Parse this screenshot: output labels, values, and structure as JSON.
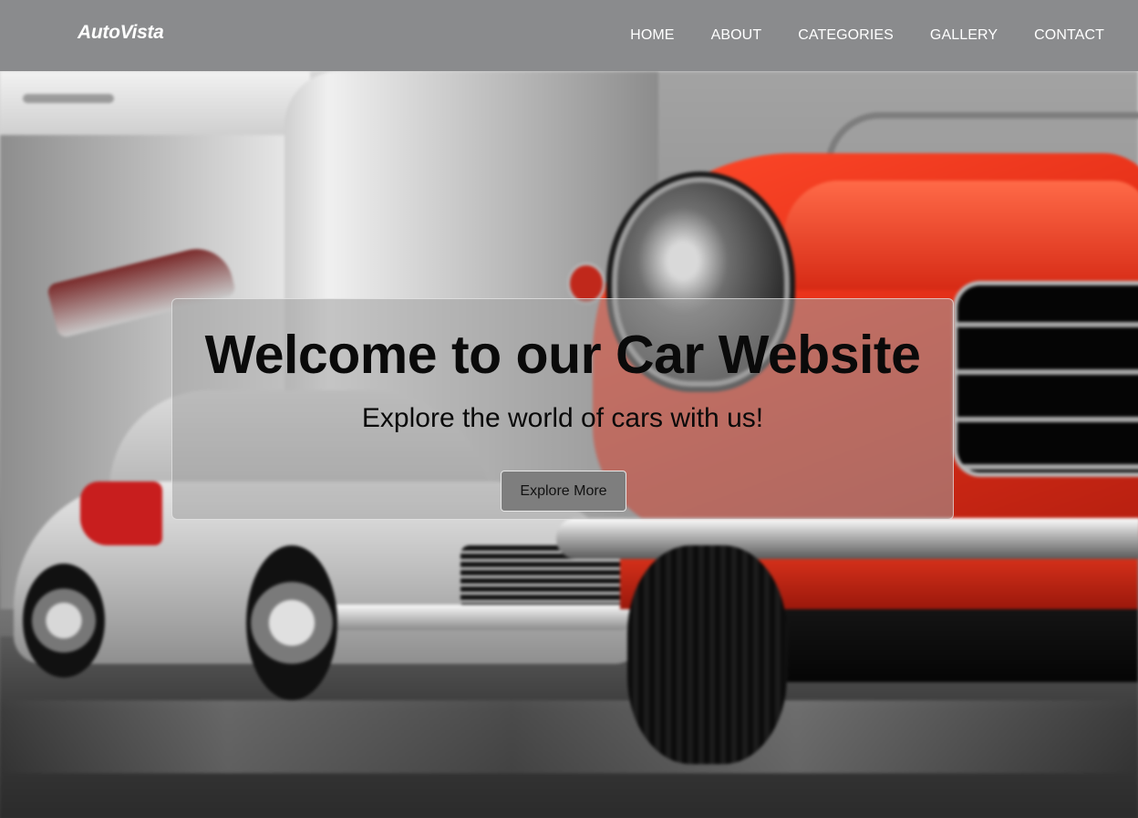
{
  "header": {
    "brand": "AutoVista",
    "nav": [
      {
        "label": "HOME"
      },
      {
        "label": "ABOUT"
      },
      {
        "label": "CATEGORIES"
      },
      {
        "label": "GALLERY"
      },
      {
        "label": "CONTACT"
      }
    ]
  },
  "hero": {
    "title": "Welcome to our Car Website",
    "subtitle": "Explore the world of cars with us!",
    "button_label": "Explore More",
    "background_image": "classic-cars-showroom-photo"
  },
  "colors": {
    "navbar_bg": "#8a8b8d",
    "nav_text": "#ffffff",
    "card_bg": "#a0a0a0",
    "button_bg": "#7e7e7e",
    "accent_red": "#e8321a"
  }
}
